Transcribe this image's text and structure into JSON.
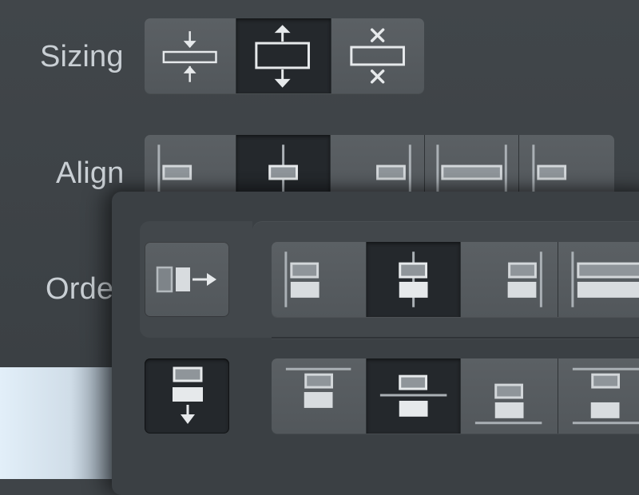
{
  "labels": {
    "sizing": "Sizing",
    "align": "Align",
    "order": "Orde"
  },
  "sizing_group": {
    "options": [
      {
        "name": "fit-content",
        "icon": "shrink-vertical-icon",
        "selected": false
      },
      {
        "name": "grow",
        "icon": "grow-vertical-icon",
        "selected": true
      },
      {
        "name": "fixed",
        "icon": "fixed-size-icon",
        "selected": false
      }
    ]
  },
  "align_group": {
    "options": [
      {
        "name": "start",
        "icon": "align-start-icon",
        "selected": false
      },
      {
        "name": "center",
        "icon": "align-center-icon",
        "selected": true
      },
      {
        "name": "end",
        "icon": "align-end-icon",
        "selected": false
      },
      {
        "name": "stretch",
        "icon": "align-stretch-icon",
        "selected": false
      },
      {
        "name": "baseline",
        "icon": "align-baseline-icon",
        "selected": false
      }
    ]
  },
  "direction_buttons": {
    "horizontal": {
      "icon": "direction-horizontal-icon",
      "selected": false
    },
    "vertical": {
      "icon": "direction-vertical-icon",
      "selected": true
    }
  },
  "cross_align_group": {
    "options": [
      {
        "name": "start",
        "icon": "cross-align-start-icon",
        "selected": false
      },
      {
        "name": "center",
        "icon": "cross-align-center-icon",
        "selected": true
      },
      {
        "name": "end",
        "icon": "cross-align-end-icon",
        "selected": false
      },
      {
        "name": "stretch",
        "icon": "cross-align-stretch-icon",
        "selected": false
      }
    ]
  },
  "main_align_group": {
    "options": [
      {
        "name": "start",
        "icon": "main-align-start-icon",
        "selected": false
      },
      {
        "name": "center",
        "icon": "main-align-center-icon",
        "selected": true
      },
      {
        "name": "end",
        "icon": "main-align-end-icon",
        "selected": false
      },
      {
        "name": "space-between",
        "icon": "main-align-between-icon",
        "selected": false
      }
    ]
  },
  "colors": {
    "background": "#3f4448",
    "segment": "#575c60",
    "segment_selected": "#24282c",
    "icon": "#e6e9eb",
    "label": "#c9cfd4"
  }
}
